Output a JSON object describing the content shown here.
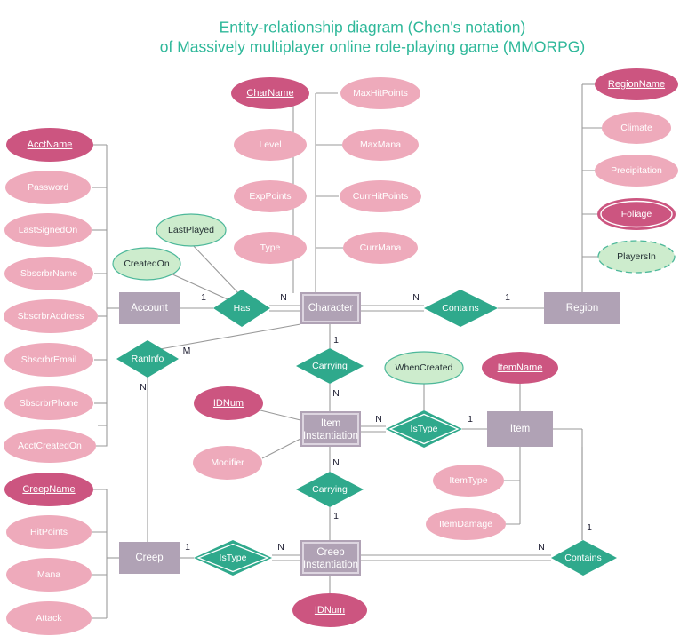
{
  "title": {
    "line1": "Entity-relationship diagram (Chen's notation)",
    "line2": "of Massively multiplayer online role-playing game (MMORPG)",
    "color": "#2fb89a"
  },
  "palette": {
    "background": "#ffffff",
    "entity_fill": "#b0a2b5",
    "attribute_fill": "#eeaabb",
    "key_attribute_fill": "#cc5580",
    "relationship_fill": "#2fa98c",
    "derived_attribute_fill": "#cdeccd",
    "connector": "#9a9a9a",
    "title_color": "#2fb89a"
  },
  "entities": [
    {
      "id": "account",
      "label": "Account",
      "weak": false
    },
    {
      "id": "character",
      "label": "Character",
      "weak": true
    },
    {
      "id": "region",
      "label": "Region",
      "weak": false
    },
    {
      "id": "item_instantiation",
      "label": "Item",
      "label2": "Instantiation",
      "weak": true
    },
    {
      "id": "item",
      "label": "Item",
      "weak": false
    },
    {
      "id": "creep",
      "label": "Creep",
      "weak": false
    },
    {
      "id": "creep_instantiation",
      "label": "Creep",
      "label2": "Instantiation",
      "weak": true
    }
  ],
  "relationships": [
    {
      "id": "has",
      "label": "Has",
      "double": false
    },
    {
      "id": "contains_region",
      "label": "Contains",
      "double": false
    },
    {
      "id": "raninfo",
      "label": "RanInfo",
      "double": false
    },
    {
      "id": "carrying_item",
      "label": "Carrying",
      "double": false
    },
    {
      "id": "istype_item",
      "label": "IsType",
      "double": true
    },
    {
      "id": "carrying_creep",
      "label": "Carrying",
      "double": false
    },
    {
      "id": "istype_creep",
      "label": "IsType",
      "double": true
    },
    {
      "id": "contains_creep",
      "label": "Contains",
      "double": false
    }
  ],
  "attributes": {
    "account": [
      {
        "label": "AcctName",
        "kind": "key"
      },
      {
        "label": "Password",
        "kind": "normal"
      },
      {
        "label": "LastSignedOn",
        "kind": "normal"
      },
      {
        "label": "SbscrbrName",
        "kind": "normal"
      },
      {
        "label": "SbscrbrAddress",
        "kind": "normal"
      },
      {
        "label": "SbscrbrEmail",
        "kind": "normal"
      },
      {
        "label": "SbscrbrPhone",
        "kind": "normal"
      },
      {
        "label": "AcctCreatedOn",
        "kind": "normal"
      }
    ],
    "creep": [
      {
        "label": "CreepName",
        "kind": "key"
      },
      {
        "label": "HitPoints",
        "kind": "normal"
      },
      {
        "label": "Mana",
        "kind": "normal"
      },
      {
        "label": "Attack",
        "kind": "normal"
      }
    ],
    "character_left": [
      {
        "label": "CharName",
        "kind": "key"
      },
      {
        "label": "Level",
        "kind": "normal"
      },
      {
        "label": "ExpPoints",
        "kind": "normal"
      },
      {
        "label": "Type",
        "kind": "normal"
      }
    ],
    "character_right": [
      {
        "label": "MaxHitPoints",
        "kind": "normal"
      },
      {
        "label": "MaxMana",
        "kind": "normal"
      },
      {
        "label": "CurrHitPoints",
        "kind": "normal"
      },
      {
        "label": "CurrMana",
        "kind": "normal"
      }
    ],
    "region": [
      {
        "label": "RegionName",
        "kind": "key"
      },
      {
        "label": "Climate",
        "kind": "normal"
      },
      {
        "label": "Precipitation",
        "kind": "normal"
      },
      {
        "label": "Foliage",
        "kind": "multivalued"
      },
      {
        "label": "PlayersIn",
        "kind": "derived"
      }
    ],
    "has_relationship": [
      {
        "label": "LastPlayed",
        "kind": "derived_plain"
      },
      {
        "label": "CreatedOn",
        "kind": "derived_plain"
      }
    ],
    "item_instantiation": [
      {
        "label": "IDNum",
        "kind": "key"
      },
      {
        "label": "Modifier",
        "kind": "normal"
      }
    ],
    "item": [
      {
        "label": "ItemName",
        "kind": "key"
      },
      {
        "label": "ItemType",
        "kind": "normal"
      },
      {
        "label": "ItemDamage",
        "kind": "normal"
      }
    ],
    "istype_item_rel": [
      {
        "label": "WhenCreated",
        "kind": "derived_plain"
      }
    ],
    "creep_instantiation": [
      {
        "label": "IDNum",
        "kind": "key"
      }
    ]
  },
  "cardinalities": {
    "account_has": "1",
    "has_character": "N",
    "character_contains": "N",
    "contains_region": "1",
    "raninfo_m": "M",
    "raninfo_n": "N",
    "character_carrying": "1",
    "carrying_item_inst": "N",
    "item_inst_istype": "N",
    "istype_item": "1",
    "item_inst_carrying": "N",
    "carrying_creep_inst": "1",
    "creep_istype": "1",
    "istype_creep_inst": "N",
    "creep_inst_contains": "N",
    "contains_item": "1"
  }
}
